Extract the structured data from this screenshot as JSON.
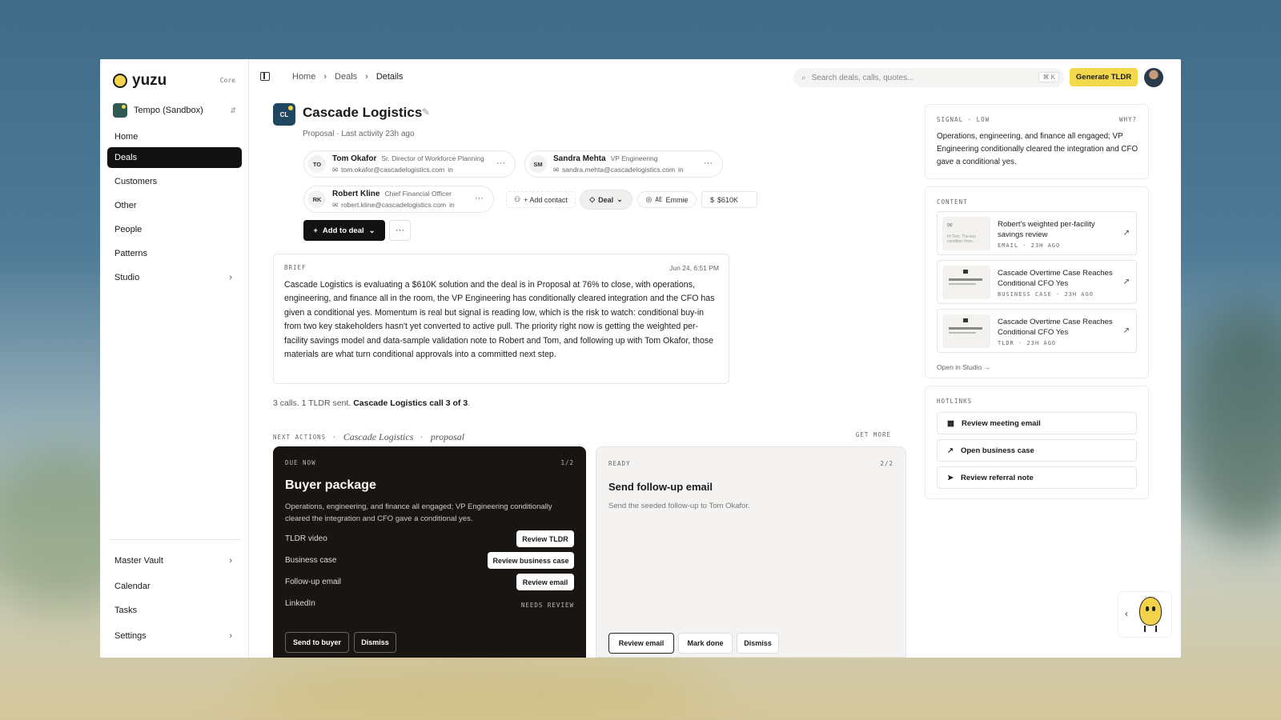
{
  "brand": {
    "name": "yuzu",
    "tier": "Core"
  },
  "workspace": {
    "name": "Tempo (Sandbox)"
  },
  "nav": {
    "items": [
      "Home",
      "Deals",
      "Customers",
      "Other",
      "People",
      "Patterns",
      "Studio"
    ],
    "bottom": [
      "Master Vault",
      "Calendar",
      "Tasks",
      "Settings"
    ]
  },
  "breadcrumb": {
    "home": "Home",
    "deals": "Deals",
    "current": "Details"
  },
  "search": {
    "placeholder": "Search deals, calls, quotes...",
    "shortcut": "⌘ K"
  },
  "generate_label": "Generate TLDR",
  "deal": {
    "initials": "CL",
    "title": "Cascade Logistics",
    "subtitle": "Proposal · Last activity 23h ago",
    "contacts": [
      {
        "initials": "TO",
        "name": "Tom Okafor",
        "role": "Sr. Director of Workforce Planning",
        "email": "tom.okafor@cascadelogistics.com"
      },
      {
        "initials": "SM",
        "name": "Sandra Mehta",
        "role": "VP Engineering",
        "email": "sandra.mehta@cascadelogistics.com"
      },
      {
        "initials": "RK",
        "name": "Robert Kline",
        "role": "Chief Financial Officer",
        "email": "robert.kline@cascadelogistics.com"
      }
    ],
    "add_contact": "+ Add contact",
    "stage": "Deal",
    "ae_label": "AE",
    "ae_name": "Emmie",
    "amount": "$610K",
    "add_to_deal": "Add to deal"
  },
  "brief": {
    "label": "BRIEF",
    "date": "Jun 24, 6:51 PM",
    "text": "Cascade Logistics is evaluating a $610K solution and the deal is in Proposal at 76% to close, with operations, engineering, and finance all in the room, the VP Engineering has conditionally cleared integration and the CFO has given a conditional yes. Momentum is real but signal is reading low, which is the risk to watch: conditional buy-in from two key stakeholders hasn't yet converted to active pull. The priority right now is getting the weighted per-facility savings model and data-sample validation note to Robert and Tom, and following up with Tom Okafor, those materials are what turn conditional approvals into a committed next step."
  },
  "calls": {
    "text": "3 calls. 1 TLDR sent.",
    "link": "Cascade Logistics call 3 of 3",
    "end": "."
  },
  "next_actions": {
    "label": "NEXT ACTIONS",
    "account": "Cascade Logistics",
    "stage": "proposal",
    "get_more": "GET MORE",
    "due": {
      "label": "DUE NOW",
      "count": "1/2",
      "title": "Buyer package",
      "desc": "Operations, engineering, and finance all engaged; VP Engineering conditionally cleared the integration and CFO gave a conditional yes.",
      "rows": [
        {
          "name": "TLDR video",
          "action": "Review TLDR"
        },
        {
          "name": "Business case",
          "action": "Review business case"
        },
        {
          "name": "Follow-up email",
          "action": "Review email"
        },
        {
          "name": "LinkedIn",
          "status": "NEEDS REVIEW"
        }
      ],
      "send": "Send to buyer",
      "dismiss": "Dismiss"
    },
    "ready": {
      "label": "READY",
      "count": "2/2",
      "title": "Send follow-up email",
      "desc": "Send the seeded follow-up to Tom Okafor.",
      "review": "Review email",
      "done": "Mark done",
      "dismiss": "Dismiss"
    }
  },
  "signal": {
    "label": "SIGNAL",
    "level": "LOW",
    "why": "WHY?",
    "text": "Operations, engineering, and finance all engaged; VP Engineering conditionally cleared the integration and CFO gave a conditional yes."
  },
  "content": {
    "label": "CONTENT",
    "items": [
      {
        "title": "Robert's weighted per-facility savings review",
        "type": "EMAIL",
        "age": "23H AGO",
        "thumb": "Hi Tom, The key condition from..."
      },
      {
        "title": "Cascade Overtime Case Reaches Conditional CFO Yes",
        "type": "BUSINESS CASE",
        "age": "23H AGO"
      },
      {
        "title": "Cascade Overtime Case Reaches Conditional CFO Yes",
        "type": "TLDR",
        "age": "23H AGO"
      }
    ],
    "open_studio": "Open in Studio →"
  },
  "hotlinks": {
    "label": "HOTLINKS",
    "items": [
      "Review meeting email",
      "Open business case",
      "Review referral note"
    ]
  }
}
